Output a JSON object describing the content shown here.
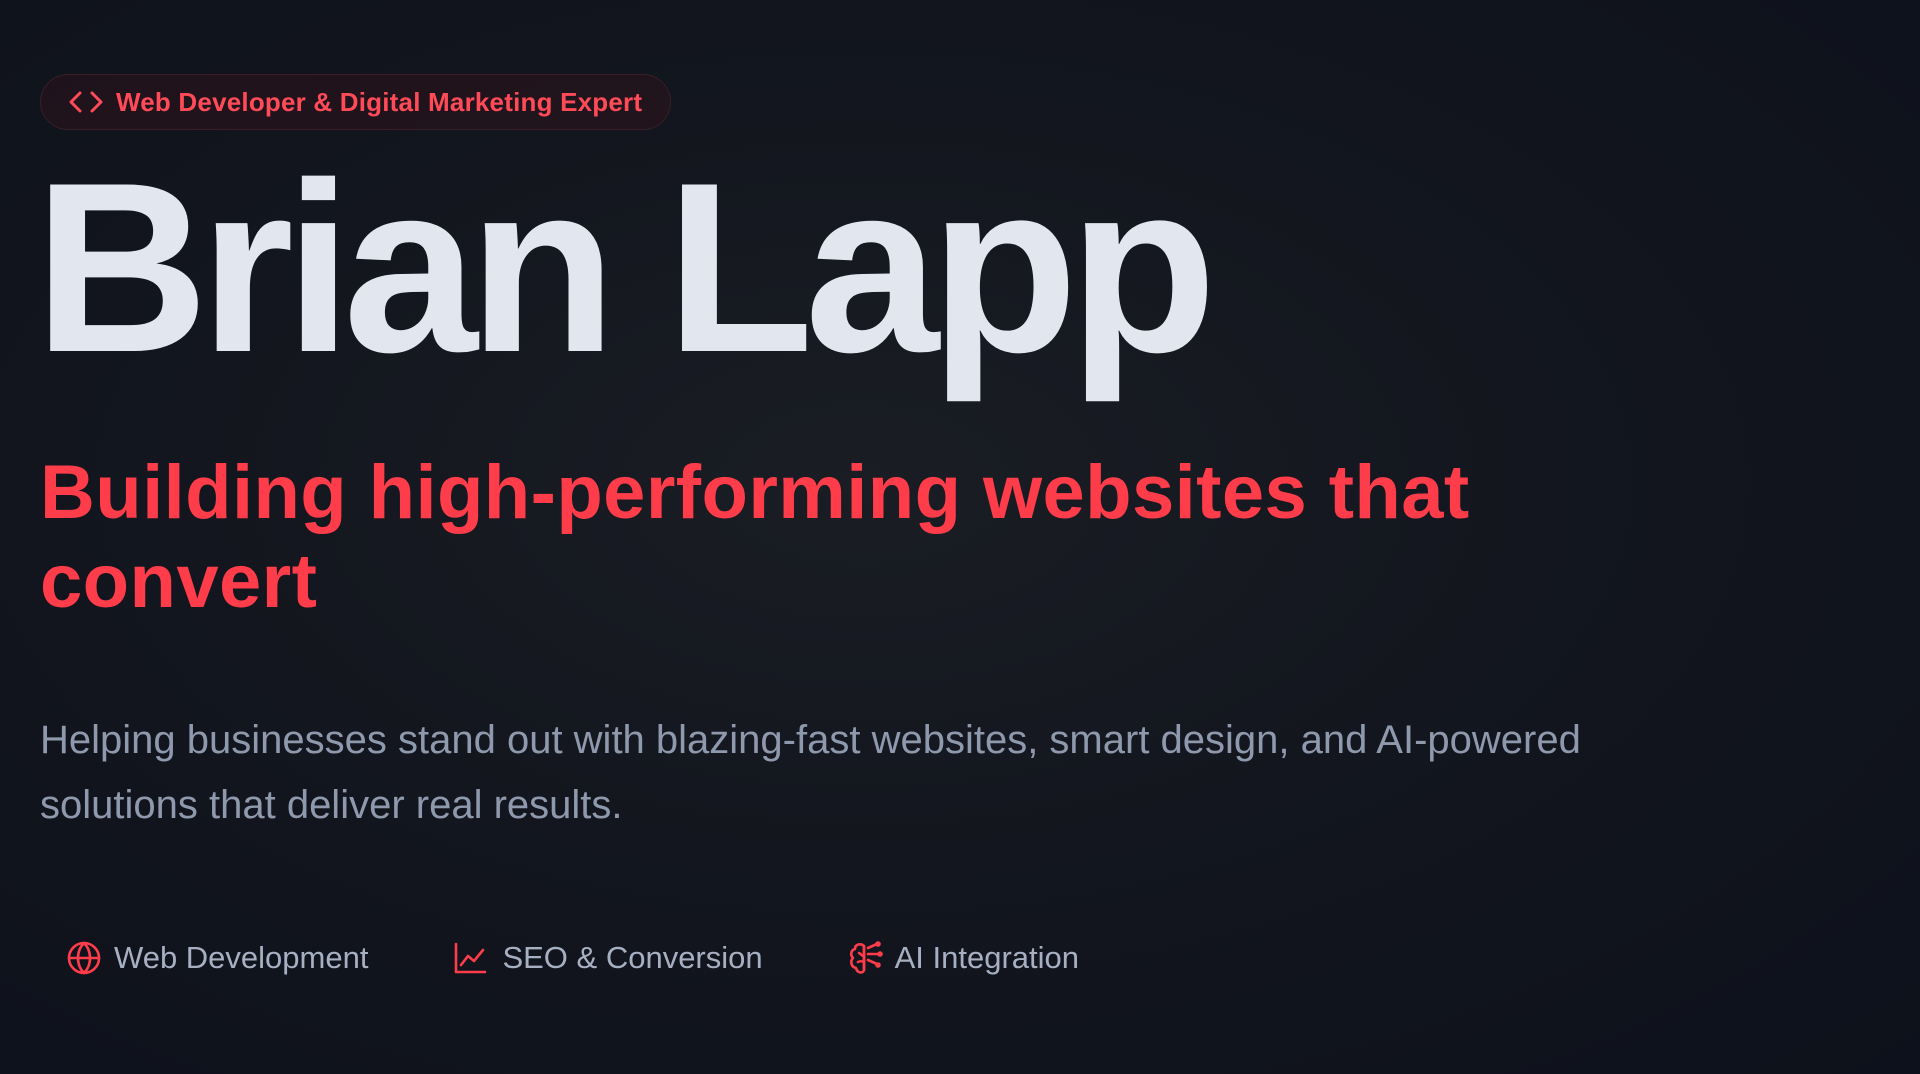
{
  "badge": {
    "icon": "code-brackets-icon",
    "label": "Web Developer & Digital Marketing Expert"
  },
  "hero": {
    "name": "Brian Lapp",
    "tagline": "Building high-performing websites that convert",
    "description": "Helping businesses stand out with blazing-fast websites, smart design, and AI-powered solutions that deliver real results."
  },
  "services": [
    {
      "icon": "globe-icon",
      "label": "Web Development"
    },
    {
      "icon": "line-chart-icon",
      "label": "SEO & Conversion"
    },
    {
      "icon": "brain-icon",
      "label": "AI Integration"
    }
  ],
  "colors": {
    "accent": "#ff3d4a",
    "heading": "#e2e6ef",
    "body_text": "#8f99ad",
    "background": "#0d111b"
  }
}
